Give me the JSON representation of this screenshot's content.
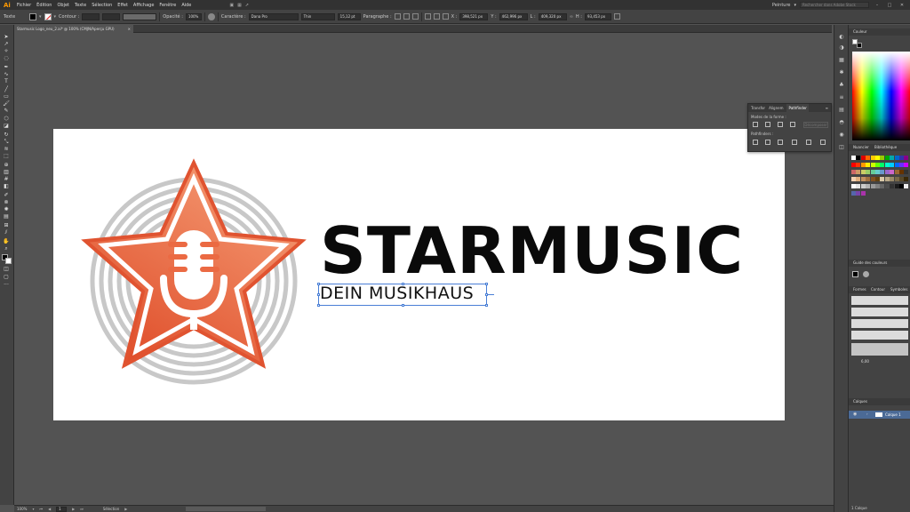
{
  "menubar": {
    "logo": "Ai",
    "items": [
      "Fichier",
      "Édition",
      "Objet",
      "Texte",
      "Sélection",
      "Effet",
      "Affichage",
      "Fenêtre",
      "Aide"
    ],
    "workspace": "Peinture",
    "search_placeholder": "Rechercher dans Adobe Stock",
    "win_min": "–",
    "win_max": "□",
    "win_close": "✕"
  },
  "controlbar": {
    "tool_label": "Texte",
    "stroke_label": "Contour :",
    "opacity_label": "Opacité :",
    "opacity_value": "100%",
    "char_label": "Caractère :",
    "font_family": "Dana Pro",
    "font_style": "Thin",
    "font_size": "15,12 pt",
    "para_label": "Paragraphe :",
    "x_label": "X :",
    "x_value": "398,521 px",
    "y_label": "Y :",
    "y_value": "462,996 px",
    "w_label": "L :",
    "w_value": "409,320 px",
    "h_label": "H :",
    "h_value": "93,453 px"
  },
  "document": {
    "tab_title": "Starmusic Logo_neu_2.ai* @ 100% (CMJN/Aperçu GPU)",
    "close": "×"
  },
  "artwork": {
    "title": "STARMUSIC",
    "subtitle": "DEIN MUSIKHAUS",
    "colors": {
      "star_light": "#f08a64",
      "star_dark": "#e05330",
      "rings": "#c8c8c8",
      "text": "#0a0a0a",
      "selection": "#4a7fd6"
    }
  },
  "pathfinder": {
    "tabs": [
      "Transfor",
      "Alignem",
      "Pathfinder"
    ],
    "shape_modes_label": "Modes de la forme :",
    "pathfinders_label": "Pathfinders :",
    "expand_label": "Décomposer"
  },
  "panels": {
    "color_tab": "Couleur",
    "swatches_tab": "Nuancier",
    "library_tab": "Bibliothèque",
    "guide_tab": "Guide des couleurs",
    "brushes_tabs": [
      "Formes",
      "Contour",
      "Symboles"
    ],
    "brush_size": "6,00",
    "layers_tab": "Calques",
    "layer_name": "Calque 1",
    "layers_count": "1 Calque"
  },
  "statusbar": {
    "zoom": "100%",
    "page": "1",
    "tool_status": "Sélection"
  }
}
